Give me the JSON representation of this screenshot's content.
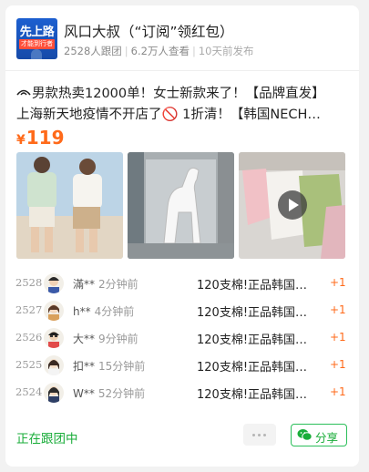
{
  "header": {
    "logo_text_main": "先上路",
    "logo_text_sub": "才能到行者",
    "title": "风口大叔（“订阅”领红包）",
    "followers": "2528人跟团",
    "views": "6.2万人查看",
    "published": "10天前发布"
  },
  "post": {
    "line1": "男款热卖12000单！女士新款来了！【品牌直发】",
    "line2": "上海新天地疫情不开店了🚫 1折清！【韩国NECH…",
    "currency": "¥",
    "price": "119"
  },
  "orders": [
    {
      "num": "2528",
      "name": "滿**",
      "time": "2分钟前",
      "item": "120支棉!正品韩国…",
      "qty": "+1"
    },
    {
      "num": "2527",
      "name": "h**",
      "time": "4分钟前",
      "item": "120支棉!正品韩国…",
      "qty": "+1"
    },
    {
      "num": "2526",
      "name": "大**",
      "time": "9分钟前",
      "item": "120支棉!正品韩国…",
      "qty": "+1"
    },
    {
      "num": "2525",
      "name": "扣**",
      "time": "15分钟前",
      "item": "120支棉!正品韩国…",
      "qty": "+1"
    },
    {
      "num": "2524",
      "name": "W**",
      "time": "52分钟前",
      "item": "120支棉!正品韩国…",
      "qty": "+1"
    }
  ],
  "footer": {
    "status": "正在跟团中",
    "share_label": "分享"
  },
  "icons": {
    "eye": "eye-icon",
    "more": "more-dots-icon",
    "share": "wechat-icon",
    "play": "play-icon"
  },
  "colors": {
    "price": "#ff6a1a",
    "accent_green": "#1aad3a",
    "logo_blue": "#1c5fd0"
  }
}
